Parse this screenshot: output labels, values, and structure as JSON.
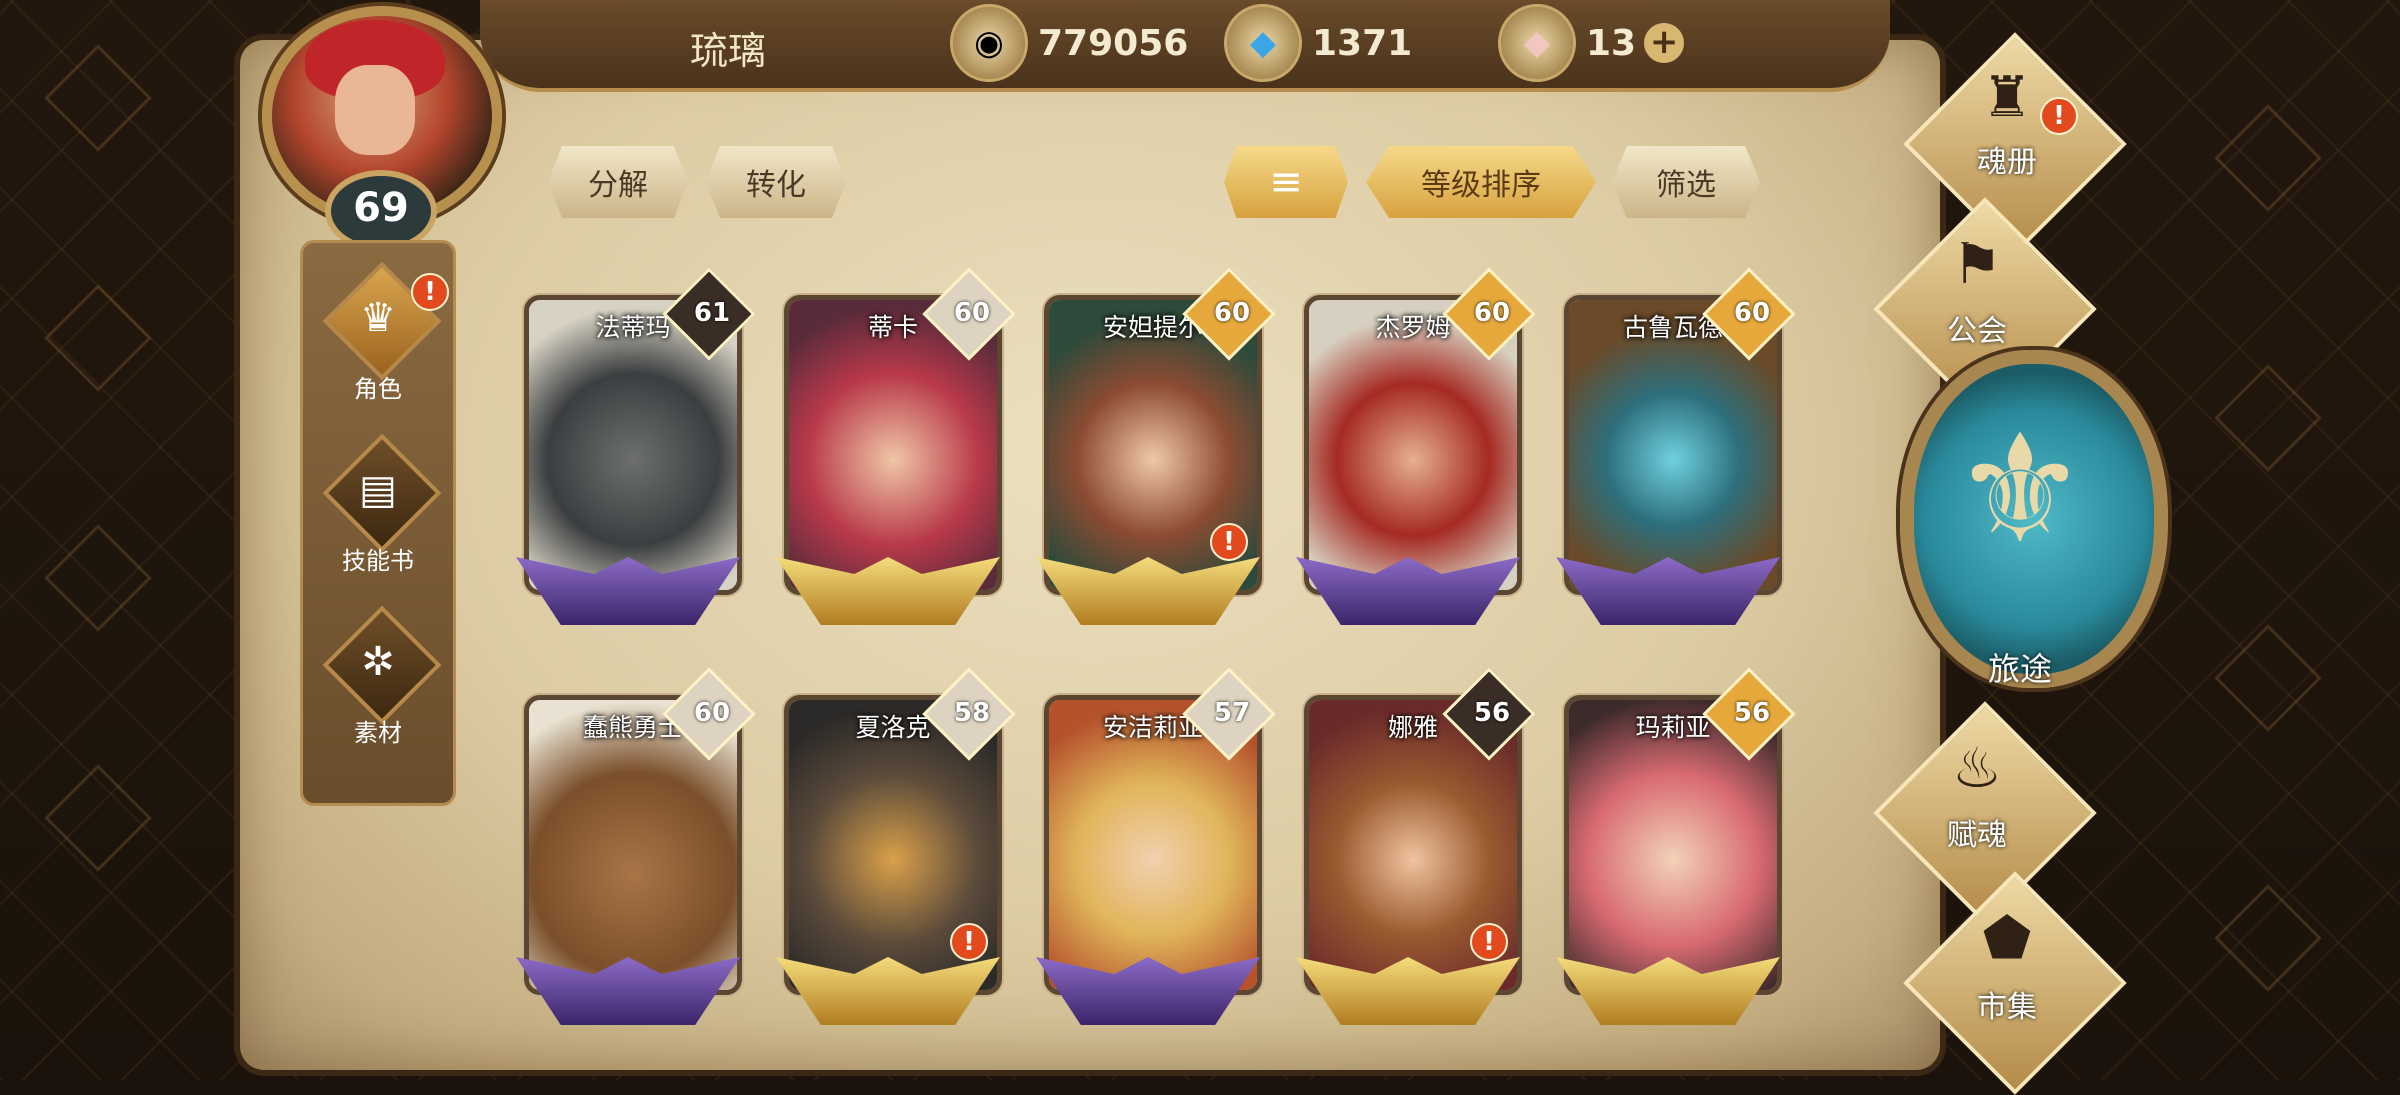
{
  "header": {
    "player_name": "琉璃",
    "player_level": "69",
    "resources": [
      {
        "icon": "gold-coin-icon",
        "value": "779056"
      },
      {
        "icon": "blue-crystal-icon",
        "value": "1371"
      },
      {
        "icon": "pink-gem-icon",
        "value": "13",
        "has_add": true,
        "add_label": "+"
      }
    ]
  },
  "left_nav": [
    {
      "label": "角色",
      "icon": "character-icon",
      "active": true,
      "alert": "!"
    },
    {
      "label": "技能书",
      "icon": "skill-book-icon",
      "active": false
    },
    {
      "label": "素材",
      "icon": "material-icon",
      "active": false
    }
  ],
  "toolbar": {
    "decompose": "分解",
    "convert": "转化",
    "sort_icon": "sort-icon",
    "sort_by_level": "等级排序",
    "filter": "筛选"
  },
  "heroes": [
    {
      "name": "法蒂玛",
      "level": "61",
      "badge": "dark",
      "wing": "purple",
      "alert": false
    },
    {
      "name": "蒂卡",
      "level": "60",
      "badge": "light",
      "wing": "gold",
      "alert": false
    },
    {
      "name": "安妲提尔",
      "level": "60",
      "badge": "gold",
      "wing": "gold",
      "alert": true
    },
    {
      "name": "杰罗姆",
      "level": "60",
      "badge": "gold",
      "wing": "purple",
      "alert": false
    },
    {
      "name": "古鲁瓦德",
      "level": "60",
      "badge": "gold",
      "wing": "purple",
      "alert": false
    },
    {
      "name": "蠢熊勇士",
      "level": "60",
      "badge": "light",
      "wing": "purple",
      "alert": false
    },
    {
      "name": "夏洛克",
      "level": "58",
      "badge": "light",
      "wing": "gold",
      "alert": true
    },
    {
      "name": "安洁莉亚",
      "level": "57",
      "badge": "light",
      "wing": "purple",
      "alert": false
    },
    {
      "name": "娜雅",
      "level": "56",
      "badge": "dark",
      "wing": "gold",
      "alert": true
    },
    {
      "name": "玛莉亚",
      "level": "56",
      "badge": "gold",
      "wing": "gold",
      "alert": false
    }
  ],
  "right_nav": [
    {
      "label": "魂册",
      "icon": "soul-book-icon",
      "alert": "!"
    },
    {
      "label": "公会",
      "icon": "guild-flag-icon"
    },
    {
      "label": "旅途",
      "icon": "journey-emblem-icon"
    },
    {
      "label": "赋魂",
      "icon": "soul-flame-icon"
    },
    {
      "label": "市集",
      "icon": "market-gem-icon"
    }
  ],
  "alert_mark": "!"
}
